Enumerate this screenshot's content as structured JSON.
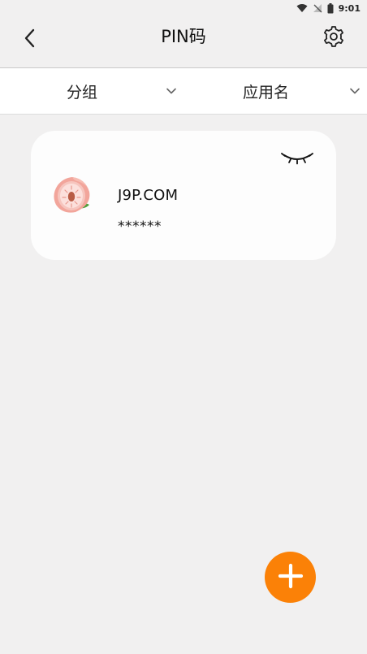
{
  "status_bar": {
    "time": "9:01",
    "icons": [
      "wifi-icon",
      "no-signal-icon",
      "battery-icon"
    ]
  },
  "header": {
    "title": "PIN码",
    "back_icon": "back-arrow-icon",
    "settings_icon": "gear-icon"
  },
  "filters": {
    "group_label": "分组",
    "app_label": "应用名"
  },
  "entries": [
    {
      "name": "J9P.COM",
      "pin_masked": "******",
      "icon": "peach-app-icon",
      "visibility_icon": "eye-closed-icon"
    }
  ],
  "fab": {
    "icon": "plus-icon",
    "color": "#fb8107"
  },
  "colors": {
    "background": "#f1f0f0",
    "card": "#fdfdfd",
    "accent": "#fb8107"
  }
}
